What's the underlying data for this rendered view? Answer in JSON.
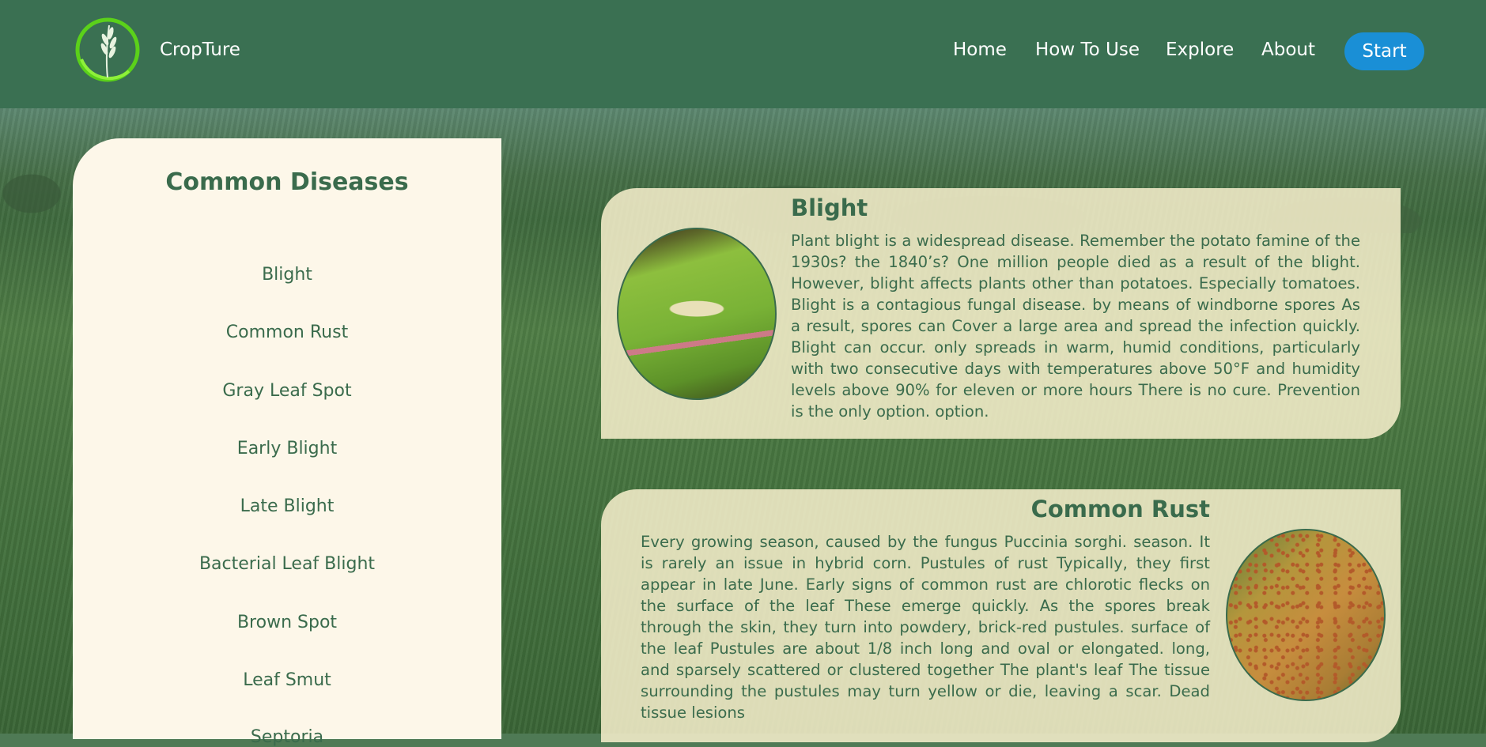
{
  "header": {
    "brand": "CropTure",
    "nav": [
      "Home",
      "How To Use",
      "Explore",
      "About"
    ],
    "start_label": "Start"
  },
  "sidebar": {
    "title": "Common Diseases",
    "items": [
      "Blight",
      "Common Rust",
      "Gray Leaf Spot",
      "Early Blight",
      "Late Blight",
      "Bacterial Leaf Blight",
      "Brown Spot",
      "Leaf Smut",
      "Septoria"
    ]
  },
  "cards": [
    {
      "title": "Blight",
      "text": "Plant blight is a widespread disease. Remember the potato famine of the 1930s? the 1840’s? One million people died as a result of the blight. However, blight affects plants other than potatoes. Especially tomatoes. Blight is a contagious fungal disease. by means of windborne spores As a result, spores can Cover a large area and spread the infection quickly. Blight can occur. only spreads in warm, humid conditions, particularly with two consecutive days with temperatures above 50°F and humidity levels above 90% for eleven or more hours There is no cure. Prevention is the only option. option."
    },
    {
      "title": "Common Rust",
      "text": "Every growing season, caused by the fungus Puccinia sorghi. season. It is rarely an issue in hybrid corn. Pustules of rust Typically, they first appear in late June. Early signs of common rust are chlorotic flecks on the surface of the leaf These emerge quickly. As the spores break through the skin, they turn into powdery, brick-red pustules. surface of the leaf Pustules are about 1/8 inch long and oval or elongated. long, and sparsely scattered or clustered together The plant's leaf The tissue surrounding the pustules may turn yellow or die, leaving a scar. Dead tissue lesions"
    }
  ],
  "colors": {
    "header_bg": "#3a7052",
    "accent_text": "#3a6b4c",
    "start_button": "#1a8fd6",
    "sidebar_bg": "#fdf7e9"
  },
  "icons": [
    "wheat-logo-icon"
  ]
}
